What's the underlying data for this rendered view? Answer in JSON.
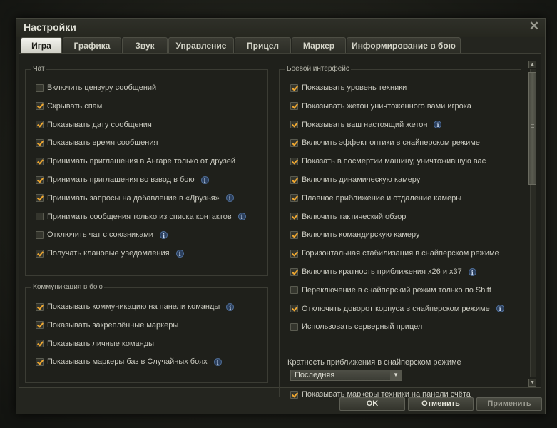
{
  "window": {
    "title": "Настройки",
    "close_glyph": "✕"
  },
  "tabs": [
    {
      "label": "Игра",
      "active": true
    },
    {
      "label": "Графика"
    },
    {
      "label": "Звук"
    },
    {
      "label": "Управление"
    },
    {
      "label": "Прицел"
    },
    {
      "label": "Маркер"
    },
    {
      "label": "Информирование в бою"
    }
  ],
  "chat": {
    "title": "Чат",
    "items": [
      {
        "label": "Включить цензуру сообщений",
        "checked": false,
        "info": false
      },
      {
        "label": "Скрывать спам",
        "checked": true,
        "info": false
      },
      {
        "label": "Показывать дату сообщения",
        "checked": true,
        "info": false
      },
      {
        "label": "Показывать время сообщения",
        "checked": true,
        "info": false
      },
      {
        "label": "Принимать приглашения в Ангаре только от друзей",
        "checked": true,
        "info": false
      },
      {
        "label": "Принимать приглашения во взвод в бою",
        "checked": true,
        "info": true
      },
      {
        "label": "Принимать запросы на добавление в «Друзья»",
        "checked": true,
        "info": true
      },
      {
        "label": "Принимать сообщения только из списка контактов",
        "checked": false,
        "info": true
      },
      {
        "label": "Отключить чат с союзниками",
        "checked": false,
        "info": true
      },
      {
        "label": "Получать клановые уведомления",
        "checked": true,
        "info": true
      }
    ]
  },
  "communication": {
    "title": "Коммуникация в бою",
    "items": [
      {
        "label": "Показывать коммуникацию на панели команды",
        "checked": true,
        "info": true
      },
      {
        "label": "Показывать закреплённые маркеры",
        "checked": true,
        "info": false
      },
      {
        "label": "Показывать личные команды",
        "checked": true,
        "info": false
      },
      {
        "label": "Показывать маркеры баз в Случайных боях",
        "checked": true,
        "info": true
      }
    ]
  },
  "battle_ui": {
    "title": "Боевой интерфейс",
    "items": [
      {
        "label": "Показывать уровень техники",
        "checked": true,
        "info": false
      },
      {
        "label": "Показывать жетон уничтоженного вами игрока",
        "checked": true,
        "info": false
      },
      {
        "label": "Показывать ваш настоящий жетон",
        "checked": true,
        "info": true
      },
      {
        "label": "Включить эффект оптики в снайперском режиме",
        "checked": true,
        "info": false
      },
      {
        "label": "Показать в посмертии машину, уничтожившую вас",
        "checked": true,
        "info": false
      },
      {
        "label": "Включить динамическую камеру",
        "checked": true,
        "info": false
      },
      {
        "label": "Плавное приближение и отдаление камеры",
        "checked": true,
        "info": false
      },
      {
        "label": "Включить тактический обзор",
        "checked": true,
        "info": false
      },
      {
        "label": "Включить командирскую камеру",
        "checked": true,
        "info": false
      },
      {
        "label": "Горизонтальная стабилизация в снайперском режиме",
        "checked": true,
        "info": false
      },
      {
        "label": "Включить кратность приближения x26 и x37",
        "checked": true,
        "info": true
      },
      {
        "label": "Переключение в снайперский режим только по Shift",
        "checked": false,
        "info": false
      },
      {
        "label": "Отключить доворот корпуса в снайперском режиме",
        "checked": true,
        "info": true
      },
      {
        "label": "Использовать серверный прицел",
        "checked": false,
        "info": false
      }
    ],
    "zoom_caption": "Кратность приближения в снайперском режиме",
    "zoom_value": "Последняя",
    "last_item": {
      "label": "Показывать маркеры техники на панели счёта",
      "checked": true
    }
  },
  "buttons": {
    "ok": "OK",
    "cancel": "Отменить",
    "apply": "Применить"
  },
  "icons": {
    "info_glyph": "i",
    "dropdown_arrow": "▼",
    "scroll_up": "▲",
    "scroll_down": "▼"
  },
  "colors": {
    "check": "#f0a830",
    "active_tab": "#e8e8e0",
    "info": "#2b3f5d"
  }
}
